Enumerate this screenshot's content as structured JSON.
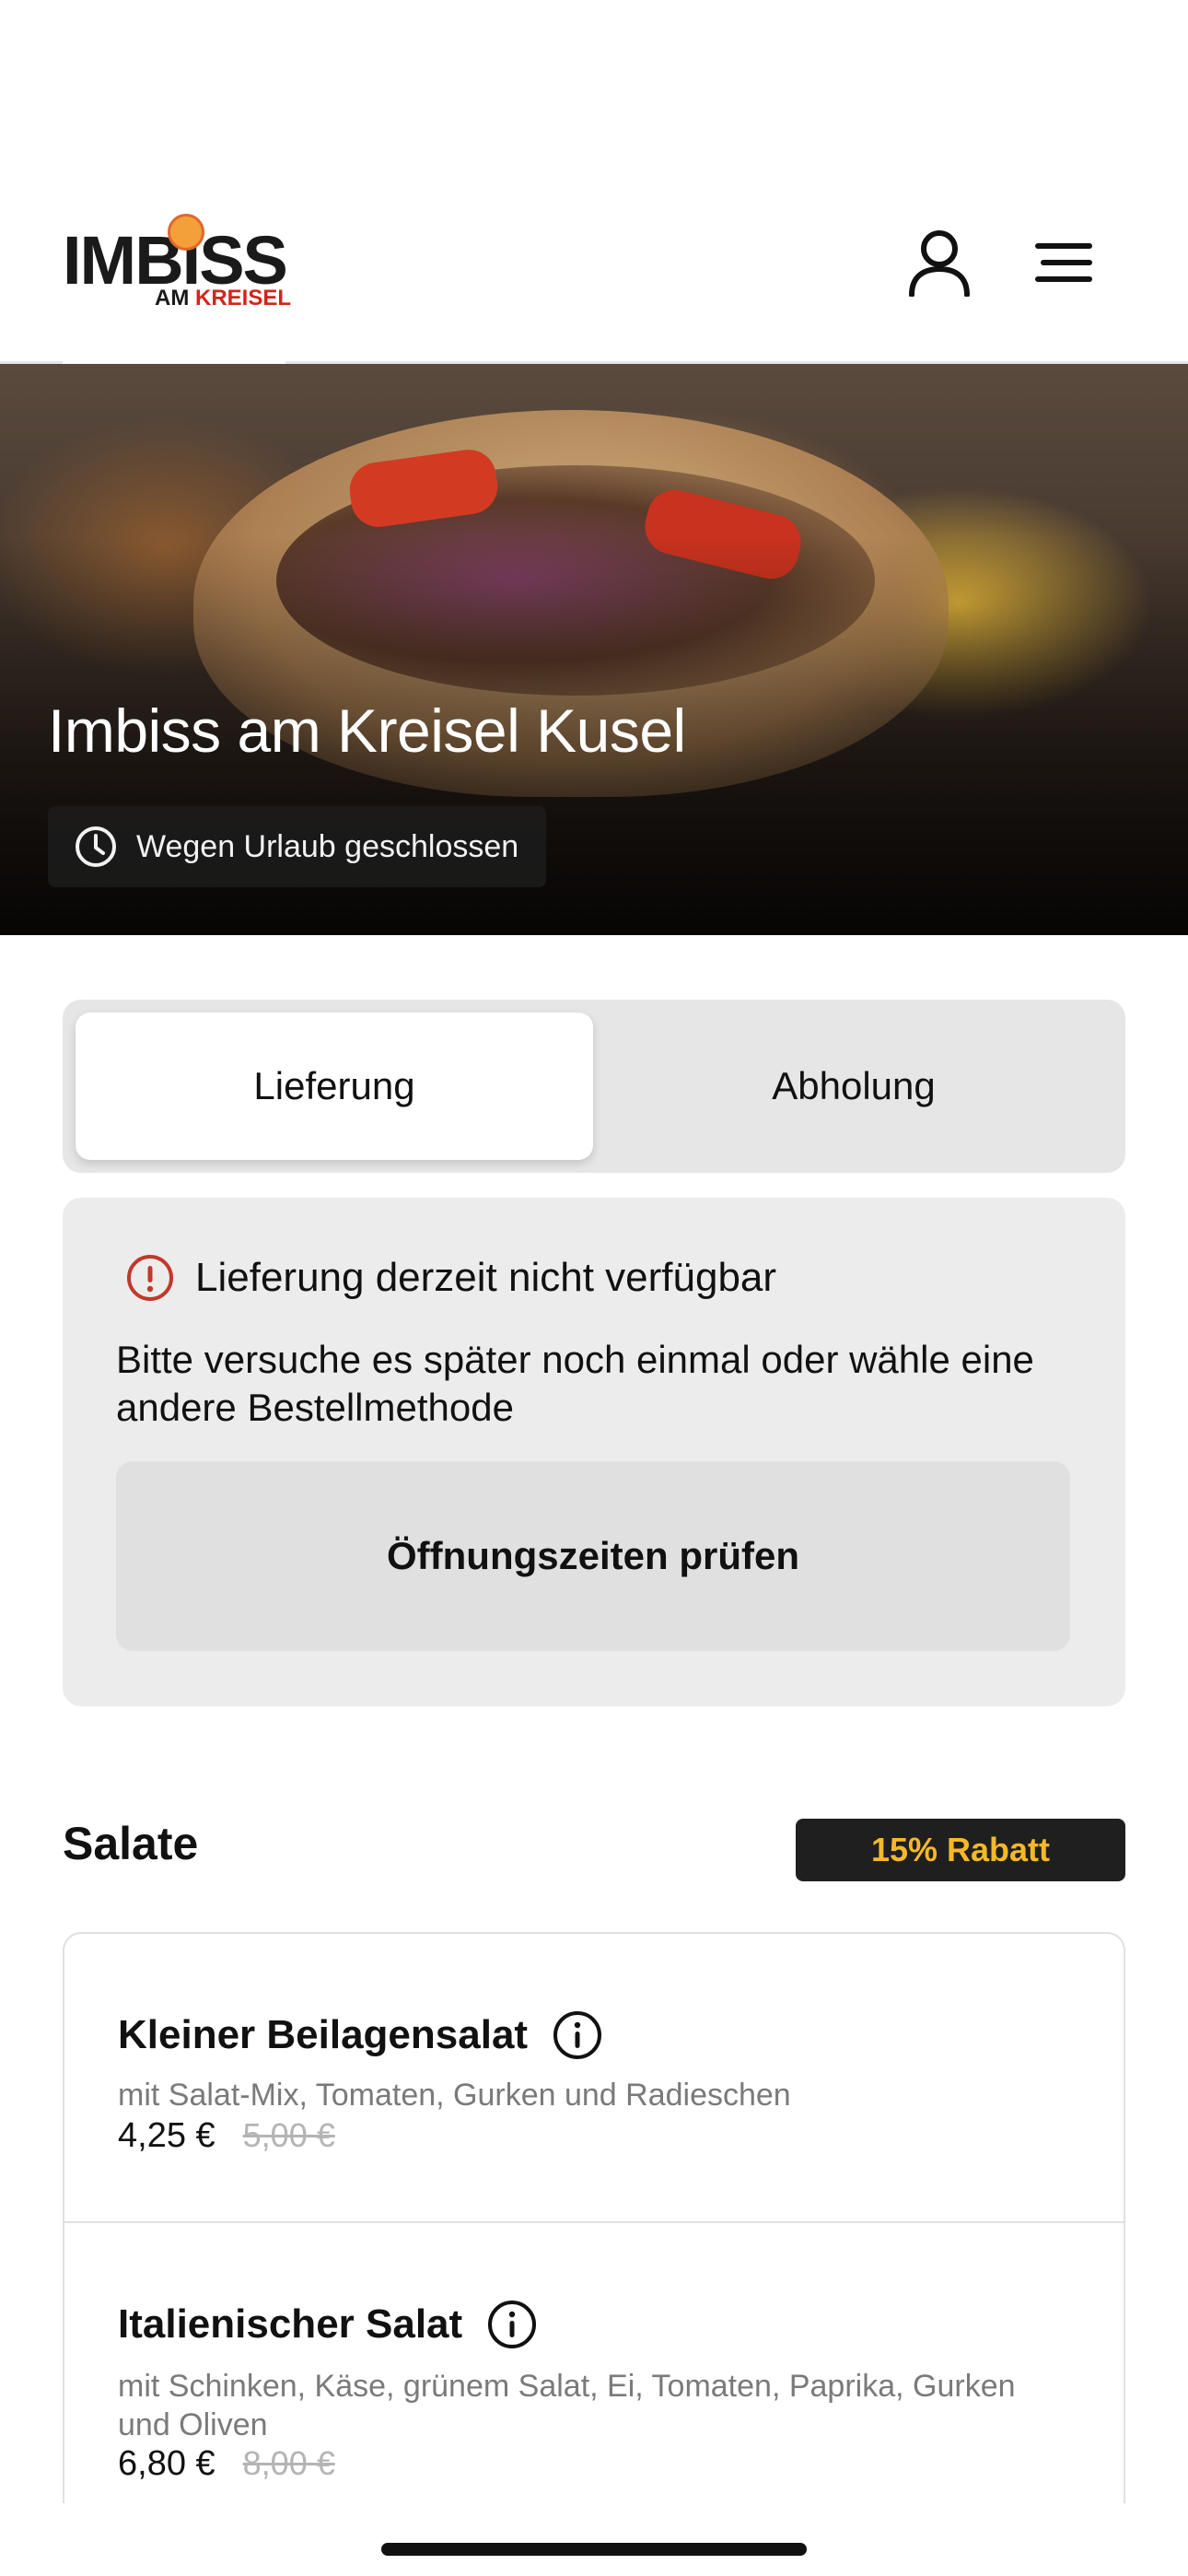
{
  "header": {
    "logo_main": "IMBISS",
    "logo_sub_prefix": "AM ",
    "logo_sub_highlight": "KREISEL",
    "user_icon": "user-icon",
    "menu_icon": "hamburger-menu-icon"
  },
  "hero": {
    "title": "Imbiss am Kreisel Kusel",
    "status_icon": "clock-icon",
    "status": "Wegen Urlaub geschlossen"
  },
  "order_mode": {
    "options": [
      "Lieferung",
      "Abholung"
    ],
    "selected": "Lieferung"
  },
  "notice": {
    "icon": "alert-info-icon",
    "title": "Lieferung derzeit nicht verfügbar",
    "body": "Bitte versuche es später noch einmal oder wähle eine andere Bestellmethode",
    "button": "Öffnungszeiten prüfen"
  },
  "section": {
    "title": "Salate",
    "discount": "15% Rabatt",
    "items": [
      {
        "name": "Kleiner Beilagensalat",
        "description": "mit Salat-Mix, Tomaten, Gurken und Radieschen",
        "price": "4,25 €",
        "old_price": "5,00 €"
      },
      {
        "name": "Italienischer Salat",
        "description": "mit Schinken, Käse, grünem Salat, Ei, Tomaten, Paprika, Gurken und Oliven",
        "price": "6,80 €",
        "old_price": "8,00 €"
      }
    ]
  },
  "colors": {
    "accent_badge_text": "#f5b82a",
    "brand_red": "#d0261c",
    "alert_red": "#c0392b"
  }
}
